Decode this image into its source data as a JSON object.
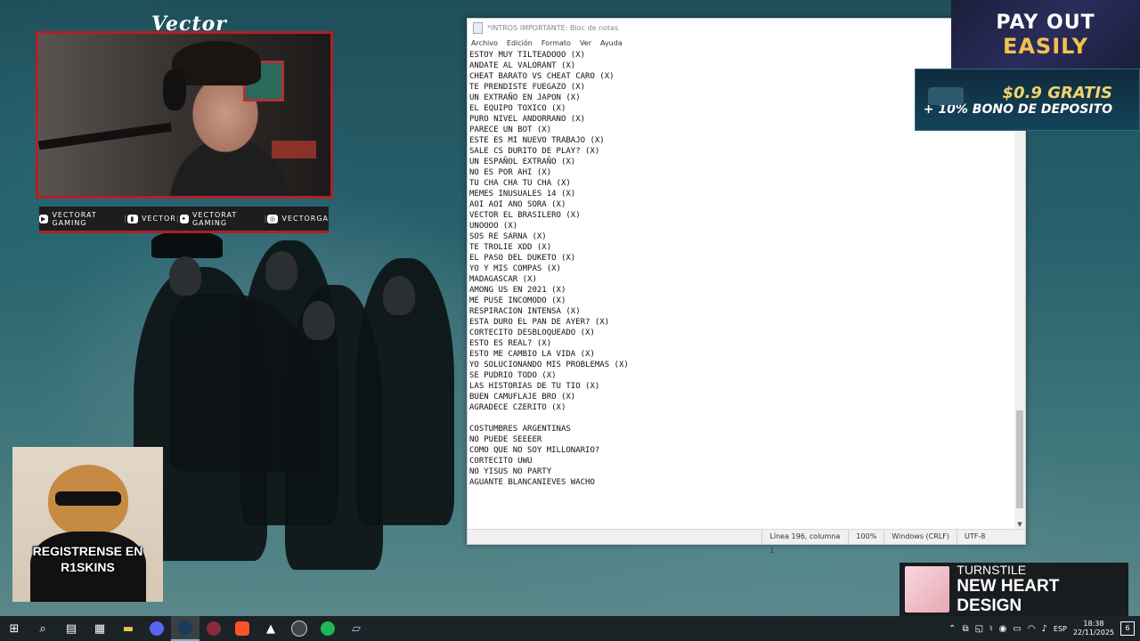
{
  "stream": {
    "cam_title": "Vector",
    "socials": [
      {
        "icon": "youtube-icon",
        "label": "VECTORAT GAMING"
      },
      {
        "icon": "twitch-icon",
        "label": "VECTOR"
      },
      {
        "icon": "twitter-icon",
        "label": "VECTORAT GAMING"
      },
      {
        "icon": "instagram-icon",
        "label": "VECTORGA"
      }
    ]
  },
  "notepad": {
    "title": "*INTROS IMPORTANTE: Bloc de notas",
    "menu": [
      "Archivo",
      "Edición",
      "Formato",
      "Ver",
      "Ayuda"
    ],
    "lines": [
      "ESTOY MUY TILTEADOOO (X)",
      "ANDATE AL VALORANT (X)",
      "CHEAT BARATO VS CHEAT CARO (X)",
      "TE PRENDISTE FUEGAZO (X)",
      "UN EXTRAÑO EN JAPON (X)",
      "EL EQUIPO TOXICO (X)",
      "PURO NIVEL ANDORRANO (X)",
      "PARECE UN BOT (X)",
      "ESTE ES MI NUEVO TRABAJO (X)",
      "SALE CS DURITO DE PLAY? (X)",
      "UN ESPAÑOL EXTRAÑO (X)",
      "NO ES POR AHI (X)",
      "TU CHA CHA TU CHA (X)",
      "MEMES INUSUALES 14 (X)",
      "AOI AOI ANO SORA (X)",
      "VECTOR EL BRASILERO (X)",
      "UNOOOO (X)",
      "SOS RE SARNA (X)",
      "TE TROLIE XDD (X)",
      "EL PASO DEL DUKETO (X)",
      "YO Y MIS COMPAS (X)",
      "MADAGASCAR (X)",
      "AMONG US EN 2021 (X)",
      "ME PUSE INCOMODO (X)",
      "RESPIRACION INTENSA (X)",
      "ESTA DURO EL PAN DE AYER? (X)",
      "CORTECITO DESBLOQUEADO (X)",
      "ESTO ES REAL? (X)",
      "ESTO ME CAMBIO LA VIDA (X)",
      "YO SOLUCIONANDO MIS PROBLEMAS (X)",
      "SE PUDRIO TODO (X)",
      "LAS HISTORIAS DE TU TIO (X)",
      "BUEN CAMUFLAJE BRO (X)",
      "AGRADECE CZERITO (X)",
      "",
      "COSTUMBRES ARGENTINAS",
      "NO PUEDE SEEEER",
      "COMO QUE NO SOY MILLONARIO?",
      "CORTECITO UWU",
      "NO YISUS NO PARTY",
      "AGUANTE BLANCANIEVES WACHO"
    ],
    "status": {
      "position": "Línea 196, columna 1",
      "zoom": "100%",
      "line_ending": "Windows (CRLF)",
      "encoding": "UTF-8"
    },
    "scroll_fraction": 0.85
  },
  "ads": {
    "payout_line1": "PAY OUT",
    "payout_line2": "EASILY",
    "bonus_line1": "$0.9 GRATIS",
    "bonus_line2": "+ 10% BONO DE DEPOSITO"
  },
  "promo": {
    "text": "REGISTRENSE EN R1SKINS"
  },
  "now_playing": {
    "artist": "TURNSTILE",
    "track": "NEW HEART DESIGN"
  },
  "taskbar": {
    "apps": [
      {
        "name": "start-button",
        "glyph": "⊞"
      },
      {
        "name": "search-button",
        "glyph": "⌕"
      },
      {
        "name": "task-view-button",
        "glyph": "▤"
      },
      {
        "name": "app-generic-button",
        "glyph": "▦"
      },
      {
        "name": "file-explorer-button",
        "glyph": "▬"
      },
      {
        "name": "discord-button",
        "glyph": "◉"
      },
      {
        "name": "steam-button",
        "glyph": "◎"
      },
      {
        "name": "valorant-button",
        "glyph": "◌"
      },
      {
        "name": "brave-button",
        "glyph": "◆"
      },
      {
        "name": "epic-button",
        "glyph": "▲"
      },
      {
        "name": "obs-button",
        "glyph": "●"
      },
      {
        "name": "spotify-button",
        "glyph": "◍"
      },
      {
        "name": "notepad-button",
        "glyph": "▱"
      }
    ],
    "language": "ESP",
    "time": "18:38",
    "date": "22/11/2025",
    "notifications": "6"
  },
  "colors": {
    "stream_red": "#b0202a",
    "payout_gold": "#f2c14e",
    "taskbar_bg": "#1c2326"
  }
}
